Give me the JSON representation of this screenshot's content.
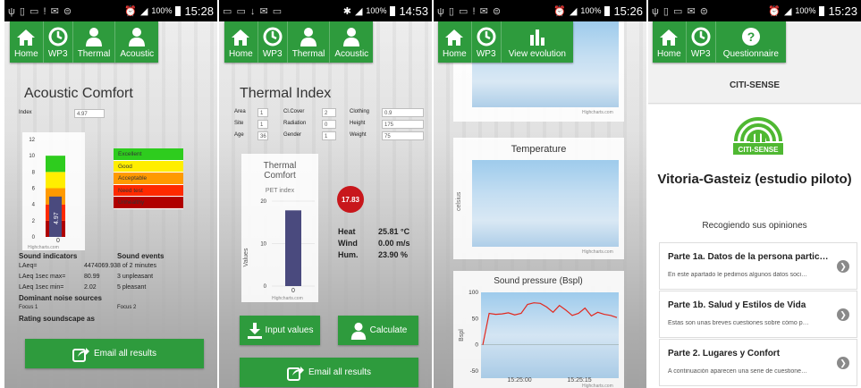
{
  "nav": {
    "home": "Home",
    "wp3": "WP3",
    "thermal": "Thermal",
    "acoustic": "Acoustic",
    "view_evolution": "View evolution",
    "questionnaire": "Questionnaire"
  },
  "status": {
    "s1": {
      "pct": "100%",
      "time": "15:28"
    },
    "s2": {
      "pct": "100%",
      "time": "14:53"
    },
    "s3": {
      "pct": "100%",
      "time": "15:26"
    },
    "s4": {
      "pct": "100%",
      "time": "15:23"
    }
  },
  "acoustic": {
    "title": "Acoustic Comfort",
    "index_label": "Index",
    "index_value": "4.97",
    "bar_value": "4.97",
    "ticks": [
      "12",
      "10",
      "8",
      "6",
      "4",
      "2",
      "0"
    ],
    "xcat": "0",
    "credit": "Highcharts.com",
    "legend": [
      "Excellent",
      "Good",
      "Acceptable",
      "Need test",
      "Unhealthy"
    ],
    "legend_colors": [
      "#2ecc1e",
      "#ffee00",
      "#ff9a00",
      "#ff2a00",
      "#b00000"
    ],
    "sound_indicators": "Sound indicators",
    "sound_events": "Sound events",
    "rows": [
      {
        "label": "LAeq=",
        "value": "4474069.93"
      },
      {
        "label": "LAeq 1sec max=",
        "value": "80.99"
      },
      {
        "label": "LAeq 1sec min=",
        "value": "2.02"
      }
    ],
    "events": [
      "8 of 2 minutes",
      "3 unpleasant",
      "5 pleasant"
    ],
    "noise_title": "Dominant noise sources",
    "focus1": "Focus 1",
    "focus2": "Focus 2",
    "rating": "Rating soundscape as",
    "email": "Email all results"
  },
  "thermal": {
    "title": "Thermal Index",
    "fields": [
      {
        "label": "Area",
        "value": "1"
      },
      {
        "label": "Cl.Cover",
        "value": "2"
      },
      {
        "label": "Clothing",
        "value": "0.9"
      },
      {
        "label": "Site",
        "value": "1"
      },
      {
        "label": "Radiation",
        "value": "0"
      },
      {
        "label": "Height",
        "value": "175"
      },
      {
        "label": "Age",
        "value": "36"
      },
      {
        "label": "Gender",
        "value": "1"
      },
      {
        "label": "Weight",
        "value": "75"
      }
    ],
    "chart_title": "Thermal Comfort",
    "chart_subtitle": "PET index",
    "ylabel": "Values",
    "ticks": [
      "20",
      "10",
      "0"
    ],
    "xcat": "0",
    "credit": "Highcharts.com",
    "badge": "17.83",
    "heat_label": "Heat",
    "heat_value": "25.81 °C",
    "wind_label": "Wind",
    "wind_value": "0.00 m/s",
    "hum_label": "Hum.",
    "hum_value": "23.90 %",
    "input_btn": "Input values",
    "calc_btn": "Calculate",
    "email": "Email all results"
  },
  "evolution": {
    "credit": "Highcharts.com",
    "temp_title": "Temperature",
    "temp_ylabel": "celsius",
    "sound_title": "Sound pressure (Bspl)",
    "sound_ylabel": "Bspl",
    "sound_ticks": [
      "100",
      "50",
      "0",
      "-50"
    ],
    "times": [
      "15:25:00",
      "15:25:15"
    ]
  },
  "questionnaire": {
    "header": "CITI-SENSE",
    "logo_text": "CITI-SENSE",
    "title": "Vitoria-Gasteiz (estudio piloto)",
    "subtitle": "Recogiendo sus opiniones",
    "items": [
      {
        "title": "Parte 1a. Datos de la persona partic…",
        "desc": "En este apartado le pedimos algunos datos soci…"
      },
      {
        "title": "Parte 1b. Salud y Estilos de Vida",
        "desc": "Estas son unas breves cuestiones sobre cómo p…"
      },
      {
        "title": "Parte 2. Lugares y Confort",
        "desc": "A continuación aparecen una serie de cuestione…"
      }
    ]
  },
  "chart_data": [
    {
      "type": "bar",
      "categories": [
        "0"
      ],
      "values": [
        4.97
      ],
      "ylim": [
        0,
        12
      ]
    },
    {
      "type": "bar",
      "title": "Thermal Comfort",
      "subtitle": "PET index",
      "ylabel": "Values",
      "categories": [
        "0"
      ],
      "values": [
        17.83
      ],
      "ylim": [
        0,
        20
      ]
    },
    {
      "type": "line",
      "title": "Sound pressure (Bspl)",
      "ylabel": "Bspl",
      "ylim": [
        -50,
        100
      ],
      "x": [
        "15:25:00",
        "15:25:15"
      ],
      "series": [
        {
          "values": [
            0,
            60,
            58,
            59,
            61,
            57,
            60,
            77,
            80,
            79,
            72,
            62,
            75,
            66,
            56,
            60,
            70,
            55,
            62,
            58,
            56,
            52
          ]
        }
      ]
    }
  ]
}
